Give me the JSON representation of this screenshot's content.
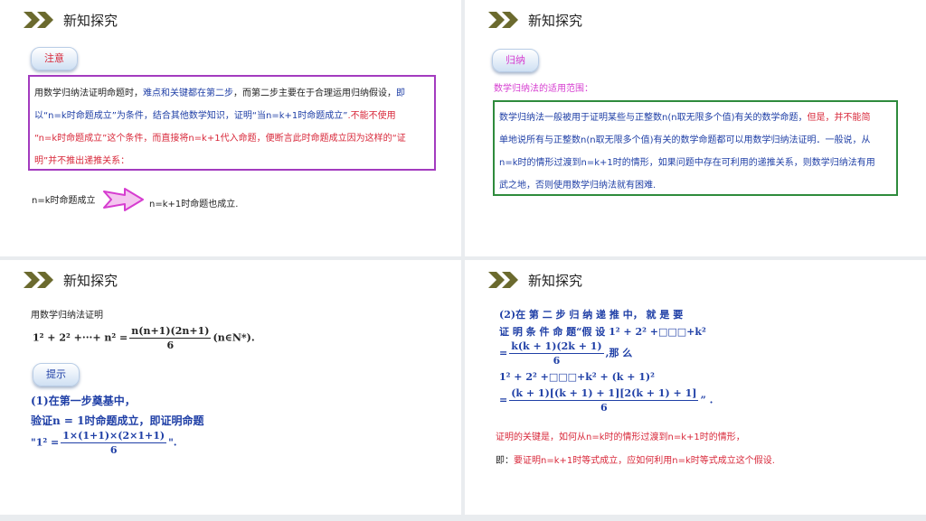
{
  "slide1": {
    "header_title": "新知探究",
    "tag_label": "注意",
    "box_line1_a": "用数学归纳法证明命题时，",
    "box_line1_b": "难点和关键都在第二步",
    "box_line1_c": "，而第二步主要在于合理运用归纳假设，",
    "box_line1_d": "即",
    "box_line2_a": "以“n=k时命题成立”为条件，结合其他数学知识，证明“当n=k+1时命题成立”",
    "box_line2_b": ".不能不使用",
    "box_line3": "“n=k时命题成立”这个条件，而直接将n=k+1代入命题，便断言此时命题成立因为这样的“证",
    "box_line4": "明”并不推出递推关系：",
    "left_text": "n=k时命题成立",
    "right_text": "n=k+1时命题也成立."
  },
  "slide2": {
    "header_title": "新知探究",
    "tag_label": "归纳",
    "subtitle": "数学归纳法的适用范围：",
    "box_line1_a": "数学归纳法一般被用于证明某些与正整数n(n取无限多个值)有关的数学命题，",
    "box_line1_b": "但是，并不能简",
    "box_line2": "单地说所有与正整数n(n取无限多个值)有关的数学命题都可以用数学归纳法证明．一般说，从",
    "box_line3": "n=k时的情形过渡到n=k+1时的情形，如果问题中存在可利用的递推关系，则数学归纳法有用",
    "box_line4": "武之地，否则使用数学归纳法就有困难."
  },
  "slide3": {
    "header_title": "新知探究",
    "intro": "用数学归纳法证明",
    "formula_left": "1² + 2² +···+ n² =",
    "formula_num": "n(n+1)(2n+1)",
    "formula_den": "6",
    "formula_tail": "(n∈N*).",
    "tag_label": "提示",
    "hint1": "(1)在第一步奠基中，",
    "hint2": "验证n = 1时命题成立，即证明命题",
    "hint3_left": "\"1² =",
    "hint3_num": "1×(1+1)×(2×1+1)",
    "hint3_den": "6",
    "hint3_tail": "\"."
  },
  "slide4": {
    "header_title": "新知探究",
    "line1": "(2)在 第 二 步 归 纳 递 推 中， 就 是 要",
    "line2": "证 明 条 件 命 题“假 设 1² + 2² +□□□+k²",
    "line3_left": "=",
    "line3_num": "k(k + 1)(2k + 1)",
    "line3_den": "6",
    "line3_tail": ",那 么",
    "line4": "1² + 2² +□□□+k² + (k + 1)²",
    "line5_left": "=",
    "line5_num": "(k + 1)[(k + 1) + 1][2(k + 1) + 1]",
    "line5_den": "6",
    "line5_tail": "” .",
    "key_point": "证明的关键是，如何从n=k时的情形过渡到n=k+1时的情形，",
    "note_prefix": "即：",
    "note_body": "要证明n=k+1时等式成立，应如何利用n=k时等式成立这个假设."
  },
  "colors": {
    "accent_chevron": "#6b6a2e",
    "red_text": "#d8283a",
    "blue_text": "#1f3fa6",
    "pink_text": "#d63dd0",
    "purple_border": "#a33bbf",
    "green_border": "#2e8b3c"
  }
}
